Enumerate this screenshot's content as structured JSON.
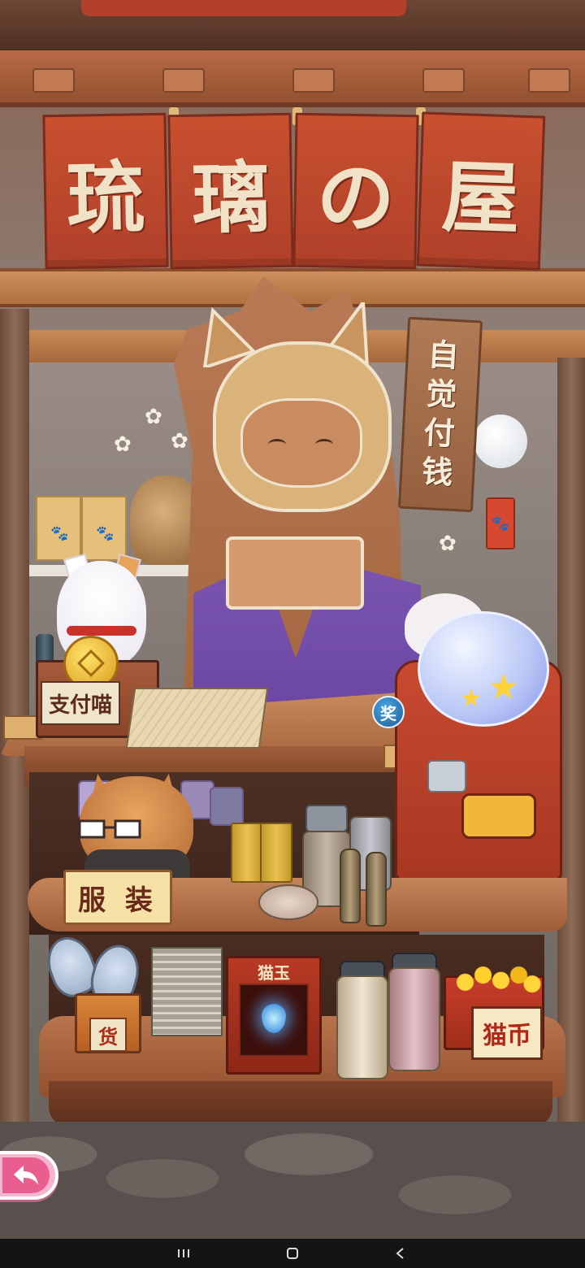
{
  "shop": {
    "sign_chars": [
      "琉",
      "璃",
      "の",
      "屋"
    ]
  },
  "honor_sign": {
    "chars": [
      "自",
      "觉",
      "付",
      "钱"
    ]
  },
  "counter": {
    "pay_cat_label": "支付喵",
    "prize_badge": "奖"
  },
  "shelves": {
    "clothing_label": "服 装",
    "goods_can_label": "货",
    "cat_jade_label": "猫玉",
    "cat_coin_label": "猫币"
  },
  "back_button": {
    "icon": "back-arrow-icon"
  },
  "colors": {
    "banner": "#c9502f",
    "banner_text": "#efe2c6",
    "back_button": "#ea5e8f",
    "prize_badge": "#2f7fc0"
  }
}
